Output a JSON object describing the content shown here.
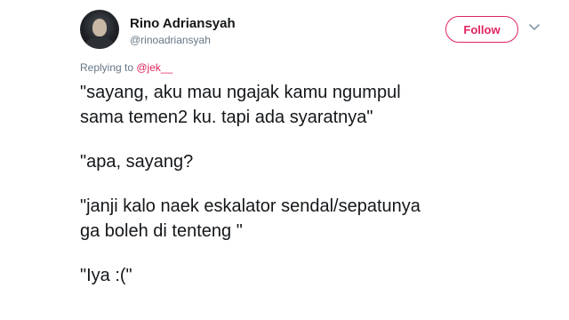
{
  "tweet": {
    "author_name": "Rino Adriansyah",
    "author_handle": "@rinoadriansyah",
    "follow_label": "Follow",
    "replying_prefix": "Replying to ",
    "replying_mention": "@jek__",
    "paragraphs": [
      {
        "lines": [
          "\"sayang, aku mau ngajak kamu ngumpul",
          "sama temen2 ku. tapi ada syaratnya\""
        ]
      },
      {
        "lines": [
          "\"apa, sayang?"
        ]
      },
      {
        "lines": [
          "\"janji kalo naek eskalator sendal/sepatunya",
          "ga boleh di tenteng \""
        ]
      },
      {
        "lines": [
          "\"Iya :(\""
        ]
      }
    ]
  },
  "icons": {
    "avatar": "profile-photo",
    "menu": "chevron-down-icon"
  },
  "colors": {
    "accent": "#e0245e",
    "text": "#14171a",
    "muted": "#657786"
  }
}
